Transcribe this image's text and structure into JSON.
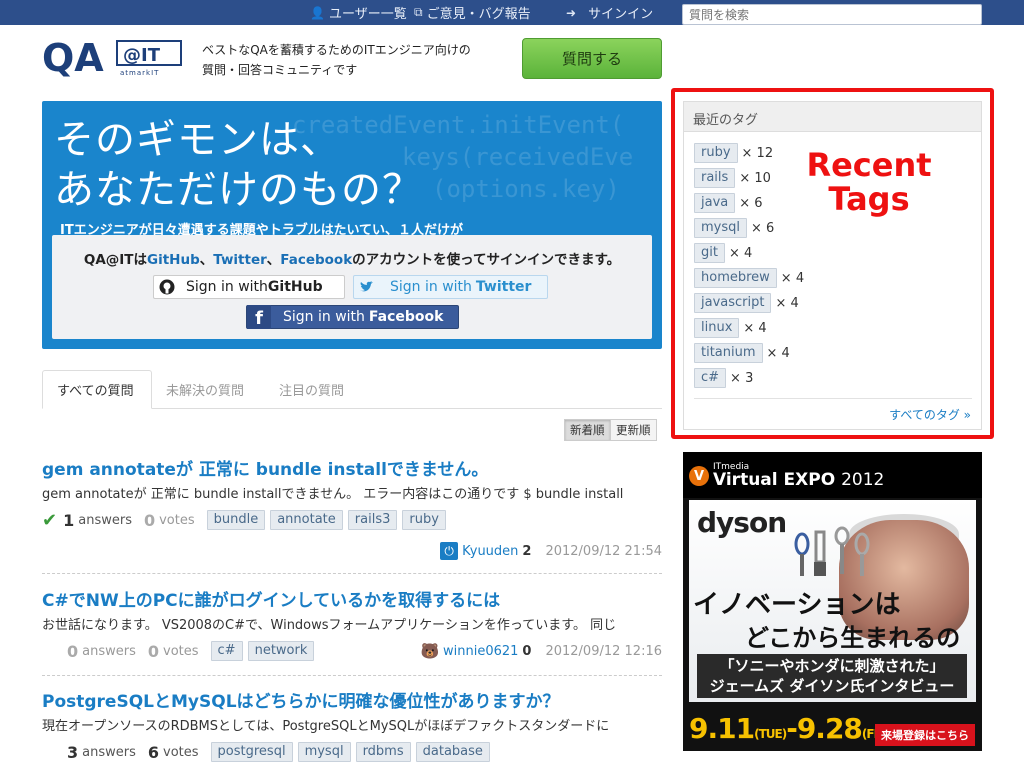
{
  "topnav": {
    "users": "ユーザー一覧",
    "feedback": "ご意見・バグ報告",
    "signin": "サインイン",
    "search_placeholder": "質問を検索"
  },
  "header": {
    "logo_main": "QA",
    "logo_sub": "@IT",
    "logo_small": "atmarkIT",
    "tagline_line1": "ベストなQAを蓄積するためのITエンジニア向けの",
    "tagline_line2": "質問・回答コミュニティです",
    "ask_button": "質問する"
  },
  "hero": {
    "headline_line1": "そのギモンは、",
    "headline_line2": "あなただけのもの？",
    "bg_code_line1": "createdEvent.initEvent(",
    "bg_code_line2": "keys(receivedEve",
    "bg_code_line3": "(options.key)",
    "subtext": "ITエンジニアが日々遭遇する課題やトラブルはたいてい、１人だけが",
    "signin_prefix": "QA@ITは",
    "signin_github": "GitHub",
    "signin_sep1": "、",
    "signin_twitter": "Twitter",
    "signin_sep2": "、",
    "signin_facebook": "Facebook",
    "signin_suffix": "のアカウントを使ってサインインできます。",
    "btn_github_pre": "Sign in with ",
    "btn_github_brand": "GitHub",
    "btn_twitter_pre": "Sign in with ",
    "btn_twitter_brand": "Twitter",
    "btn_facebook_pre": "Sign in with ",
    "btn_facebook_brand": "Facebook"
  },
  "tabs": [
    "すべての質問",
    "未解決の質問",
    "注目の質問"
  ],
  "sort": {
    "newest": "新着順",
    "updated": "更新順"
  },
  "questions": [
    {
      "title": "gem annotateが 正常に bundle installできません。",
      "excerpt": "gem annotateが 正常に bundle installできません。 エラー内容はこの通りです $ bundle install",
      "answers": "1",
      "answers_label": "answers",
      "votes": "0",
      "votes_label": "votes",
      "tags": [
        "bundle",
        "annotate",
        "rails3",
        "ruby"
      ],
      "user": "Kyuuden",
      "rep": "2",
      "date": "2012/09/12 21:54"
    },
    {
      "title": "C#でNW上のPCに誰がログインしているかを取得するには",
      "excerpt": "お世話になります。 VS2008のC#で、Windowsフォームアプリケーションを作っています。 同じ",
      "answers": "0",
      "answers_label": "answers",
      "votes": "0",
      "votes_label": "votes",
      "tags": [
        "c#",
        "network"
      ],
      "user": "winnie0621",
      "rep": "0",
      "date": "2012/09/12 12:16"
    },
    {
      "title": "PostgreSQLとMySQLはどちらかに明確な優位性がありますか？",
      "excerpt": "現在オープンソースのRDBMSとしては、PostgreSQLとMySQLがほぼデファクトスタンダードに",
      "answers": "3",
      "answers_label": "answers",
      "votes": "6",
      "votes_label": "votes",
      "tags": [
        "postgresql",
        "mysql",
        "rdbms",
        "database"
      ]
    }
  ],
  "sidebar": {
    "heading": "最近のタグ",
    "tags": [
      {
        "name": "ruby",
        "count": "× 12"
      },
      {
        "name": "rails",
        "count": "× 10"
      },
      {
        "name": "java",
        "count": "× 6"
      },
      {
        "name": "mysql",
        "count": "× 6"
      },
      {
        "name": "git",
        "count": "× 4"
      },
      {
        "name": "homebrew",
        "count": "× 4"
      },
      {
        "name": "javascript",
        "count": "× 4"
      },
      {
        "name": "linux",
        "count": "× 4"
      },
      {
        "name": "titanium",
        "count": "× 4"
      },
      {
        "name": "c#",
        "count": "× 3"
      }
    ],
    "all_tags": "すべてのタグ »",
    "annotation_line1": "Recent",
    "annotation_line2": "Tags",
    "highlight_color": "#ee1111"
  },
  "ad": {
    "brand_small": "ITmedia",
    "expo": "Virtual EXPO",
    "year": "2012",
    "dyson": "dyson",
    "headline1": "イノベーションは",
    "headline2": "どこから生まれるのか？",
    "quote1": "「ソニーやホンダに刺激された」",
    "quote2": "ジェームズ ダイソン氏インタビュー",
    "date_start": "9.11",
    "date_start_day": "(TUE)",
    "date_end": "-9.28",
    "date_end_day": "(FRI)",
    "register": "来場登録はこちら"
  }
}
